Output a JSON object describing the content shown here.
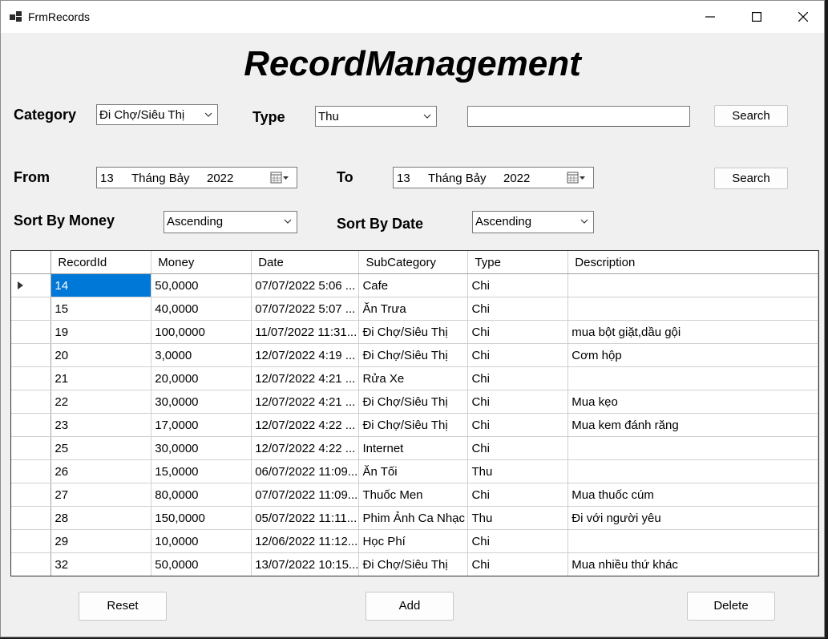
{
  "window": {
    "title": "FrmRecords"
  },
  "heading": "RecordManagement",
  "filters": {
    "category_label": "Category",
    "category_value": "Đi Chợ/Siêu Thị",
    "type_label": "Type",
    "type_value": "Thu",
    "search_text": "",
    "search_label": "Search",
    "from_label": "From",
    "from_day": "13",
    "from_month": "Tháng Bảy",
    "from_year": "2022",
    "to_label": "To",
    "to_day": "13",
    "to_month": "Tháng Bảy",
    "to_year": "2022",
    "date_search_label": "Search",
    "sort_money_label": "Sort By Money",
    "sort_money_value": "Ascending",
    "sort_date_label": "Sort By Date",
    "sort_date_value": "Ascending"
  },
  "grid": {
    "columns": [
      "RecordId",
      "Money",
      "Date",
      "SubCategory",
      "Type",
      "Description"
    ],
    "rows": [
      [
        "14",
        "50,0000",
        "07/07/2022 5:06 ...",
        "Cafe",
        "Chi",
        ""
      ],
      [
        "15",
        "40,0000",
        "07/07/2022 5:07 ...",
        "Ăn Trưa",
        "Chi",
        ""
      ],
      [
        "19",
        "100,0000",
        "11/07/2022 11:31...",
        "Đi Chợ/Siêu Thị",
        "Chi",
        "mua bột giặt,dầu gội"
      ],
      [
        "20",
        "3,0000",
        "12/07/2022 4:19 ...",
        "Đi Chợ/Siêu Thị",
        "Chi",
        "Cơm hộp"
      ],
      [
        "21",
        "20,0000",
        "12/07/2022 4:21 ...",
        "Rửa Xe",
        "Chi",
        ""
      ],
      [
        "22",
        "30,0000",
        "12/07/2022 4:21 ...",
        "Đi Chợ/Siêu Thị",
        "Chi",
        "Mua kẹo"
      ],
      [
        "23",
        "17,0000",
        "12/07/2022 4:22 ...",
        "Đi Chợ/Siêu Thị",
        "Chi",
        "Mua kem đánh răng"
      ],
      [
        "25",
        "30,0000",
        "12/07/2022 4:22 ...",
        "Internet",
        "Chi",
        ""
      ],
      [
        "26",
        "15,0000",
        "06/07/2022 11:09...",
        "Ăn Tối",
        "Thu",
        ""
      ],
      [
        "27",
        "80,0000",
        "07/07/2022 11:09...",
        "Thuốc Men",
        "Chi",
        "Mua thuốc cúm"
      ],
      [
        "28",
        "150,0000",
        "05/07/2022 11:11...",
        "Phim Ảnh Ca Nhạc",
        "Thu",
        "Đi với người yêu"
      ],
      [
        "29",
        "10,0000",
        "12/06/2022 11:12...",
        "Học Phí",
        "Chi",
        ""
      ],
      [
        "32",
        "50,0000",
        "13/07/2022 10:15...",
        "Đi Chợ/Siêu Thị",
        "Chi",
        "Mua nhiều thứ khác"
      ]
    ]
  },
  "actions": {
    "reset_label": "Reset",
    "add_label": "Add",
    "delete_label": "Delete"
  },
  "colors": {
    "selection": "#0078d7",
    "window_bg": "#f0f0f0"
  }
}
